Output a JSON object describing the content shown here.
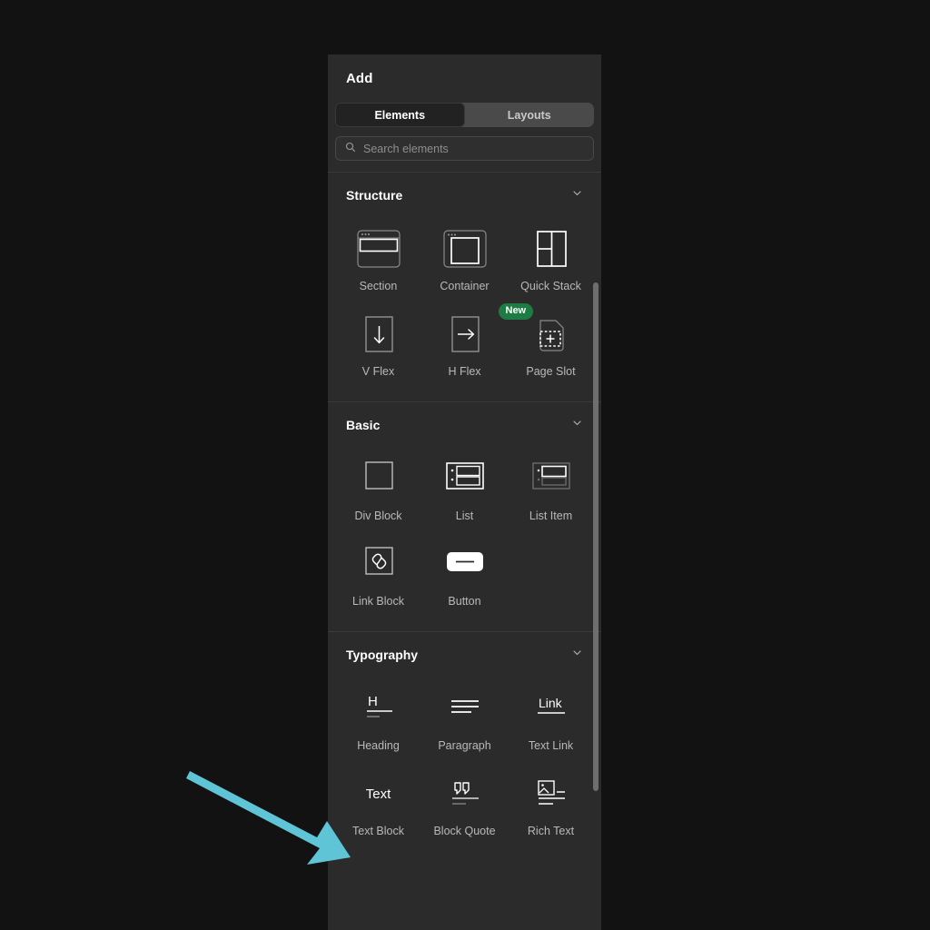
{
  "panel": {
    "title": "Add",
    "tabs": [
      {
        "label": "Elements",
        "active": true
      },
      {
        "label": "Layouts",
        "active": false
      }
    ],
    "search": {
      "placeholder": "Search elements",
      "value": "",
      "icon": "search-icon"
    },
    "sections": [
      {
        "name": "Structure",
        "collapse_icon": "chevron-down-icon",
        "items": [
          {
            "label": "Section",
            "icon": "section-icon"
          },
          {
            "label": "Container",
            "icon": "container-icon"
          },
          {
            "label": "Quick Stack",
            "icon": "quick-stack-icon"
          },
          {
            "label": "V Flex",
            "icon": "arrow-down-icon"
          },
          {
            "label": "H Flex",
            "icon": "arrow-right-icon"
          },
          {
            "label": "Page Slot",
            "icon": "page-slot-icon",
            "badge": "New"
          }
        ]
      },
      {
        "name": "Basic",
        "collapse_icon": "chevron-down-icon",
        "items": [
          {
            "label": "Div Block",
            "icon": "div-block-icon"
          },
          {
            "label": "List",
            "icon": "list-icon"
          },
          {
            "label": "List Item",
            "icon": "list-item-icon"
          },
          {
            "label": "Link Block",
            "icon": "link-icon"
          },
          {
            "label": "Button",
            "icon": "button-icon"
          }
        ]
      },
      {
        "name": "Typography",
        "collapse_icon": "chevron-down-icon",
        "items": [
          {
            "label": "Heading",
            "icon": "heading-icon"
          },
          {
            "label": "Paragraph",
            "icon": "paragraph-icon"
          },
          {
            "label": "Text Link",
            "icon": "text-link-icon"
          },
          {
            "label": "Text Block",
            "icon": "text-glyph-icon",
            "glyph": "Text"
          },
          {
            "label": "Block Quote",
            "icon": "block-quote-icon"
          },
          {
            "label": "Rich Text",
            "icon": "rich-text-icon"
          }
        ]
      }
    ]
  },
  "annotation": {
    "type": "arrow",
    "color": "#5ec4d6",
    "points_to": "Text Block"
  },
  "colors": {
    "background": "#121212",
    "panel": "#2b2b2b",
    "tab_active": "#222222",
    "tab_track": "#4a4a4a",
    "badge_green": "#1e7b43",
    "arrow_cyan": "#5ec4d6",
    "label_text": "#b9b9b9"
  }
}
